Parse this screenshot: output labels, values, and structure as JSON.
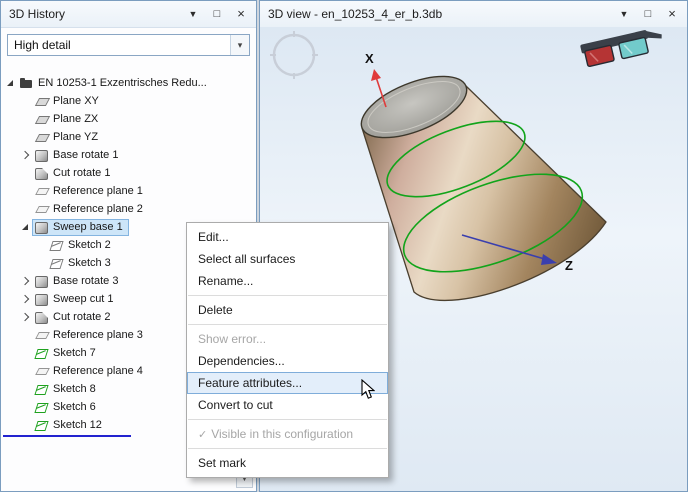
{
  "icons": {
    "pin": "▼",
    "maximize": "□",
    "close": "×",
    "dropdown": "▾",
    "check": "✓",
    "scroll_down": "▼"
  },
  "colors": {
    "selection_highlight": "#cde5f8",
    "feature_edge_green": "#12a41b",
    "axis_x_red": "#e03b3b",
    "axis_z_blue": "#3a3fae",
    "model_bronze": "#c2a87f",
    "insertion_marker_blue": "#2222cf"
  },
  "left_panel": {
    "title": "3D History",
    "detail_dropdown": {
      "value": "High detail"
    },
    "tree": {
      "items": [
        {
          "label": "EN 10253-1 Exzentrisches Redu...",
          "icon": "folder",
          "expander": "expanded",
          "level": 0,
          "selected": false
        },
        {
          "label": "Plane XY",
          "icon": "plane",
          "expander": "none",
          "level": 1,
          "selected": false
        },
        {
          "label": "Plane ZX",
          "icon": "plane",
          "expander": "none",
          "level": 1,
          "selected": false
        },
        {
          "label": "Plane YZ",
          "icon": "plane",
          "expander": "none",
          "level": 1,
          "selected": false
        },
        {
          "label": "Base rotate 1",
          "icon": "solid",
          "expander": "collapsed",
          "level": 1,
          "selected": false
        },
        {
          "label": "Cut rotate 1",
          "icon": "cut",
          "expander": "none",
          "level": 1,
          "selected": false
        },
        {
          "label": "Reference plane 1",
          "icon": "refplane",
          "expander": "none",
          "level": 1,
          "selected": false
        },
        {
          "label": "Reference plane 2",
          "icon": "refplane",
          "expander": "none",
          "level": 1,
          "selected": false
        },
        {
          "label": "Sweep base 1",
          "icon": "solid",
          "expander": "expanded",
          "level": 1,
          "selected": true
        },
        {
          "label": "Sketch 2",
          "icon": "sketch-gray",
          "expander": "none",
          "level": 2,
          "selected": false
        },
        {
          "label": "Sketch 3",
          "icon": "sketch-gray",
          "expander": "none",
          "level": 2,
          "selected": false
        },
        {
          "label": "Base rotate 3",
          "icon": "solid",
          "expander": "collapsed",
          "level": 1,
          "selected": false
        },
        {
          "label": "Sweep cut 1",
          "icon": "solid",
          "expander": "collapsed",
          "level": 1,
          "selected": false
        },
        {
          "label": "Cut rotate 2",
          "icon": "cut",
          "expander": "collapsed",
          "level": 1,
          "selected": false
        },
        {
          "label": "Reference plane 3",
          "icon": "refplane",
          "expander": "none",
          "level": 1,
          "selected": false
        },
        {
          "label": "Sketch 7",
          "icon": "sketch-green",
          "expander": "none",
          "level": 1,
          "selected": false
        },
        {
          "label": "Reference plane 4",
          "icon": "refplane",
          "expander": "none",
          "level": 1,
          "selected": false
        },
        {
          "label": "Sketch 8",
          "icon": "sketch-green",
          "expander": "none",
          "level": 1,
          "selected": false
        },
        {
          "label": "Sketch 6",
          "icon": "sketch-green",
          "expander": "none",
          "level": 1,
          "selected": false
        },
        {
          "label": "Sketch 12",
          "icon": "sketch-green",
          "expander": "none",
          "level": 1,
          "selected": false
        }
      ]
    }
  },
  "right_panel": {
    "title": "3D view - en_10253_4_er_b.3db",
    "axes": {
      "x": "X",
      "z": "Z"
    }
  },
  "context_menu": {
    "items": [
      {
        "label": "Edit...",
        "state": "normal",
        "checked": false
      },
      {
        "label": "Select all surfaces",
        "state": "normal",
        "checked": false
      },
      {
        "label": "Rename...",
        "state": "normal",
        "checked": false
      },
      {
        "type": "separator"
      },
      {
        "label": "Delete",
        "state": "normal",
        "checked": false
      },
      {
        "type": "separator"
      },
      {
        "label": "Show error...",
        "state": "disabled",
        "checked": false
      },
      {
        "label": "Dependencies...",
        "state": "normal",
        "checked": false
      },
      {
        "label": "Feature attributes...",
        "state": "highlighted",
        "checked": false
      },
      {
        "label": "Convert to cut",
        "state": "normal",
        "checked": false
      },
      {
        "type": "separator"
      },
      {
        "label": "Visible in this configuration",
        "state": "disabled",
        "checked": true
      },
      {
        "type": "separator"
      },
      {
        "label": "Set mark",
        "state": "normal",
        "checked": false
      }
    ]
  }
}
